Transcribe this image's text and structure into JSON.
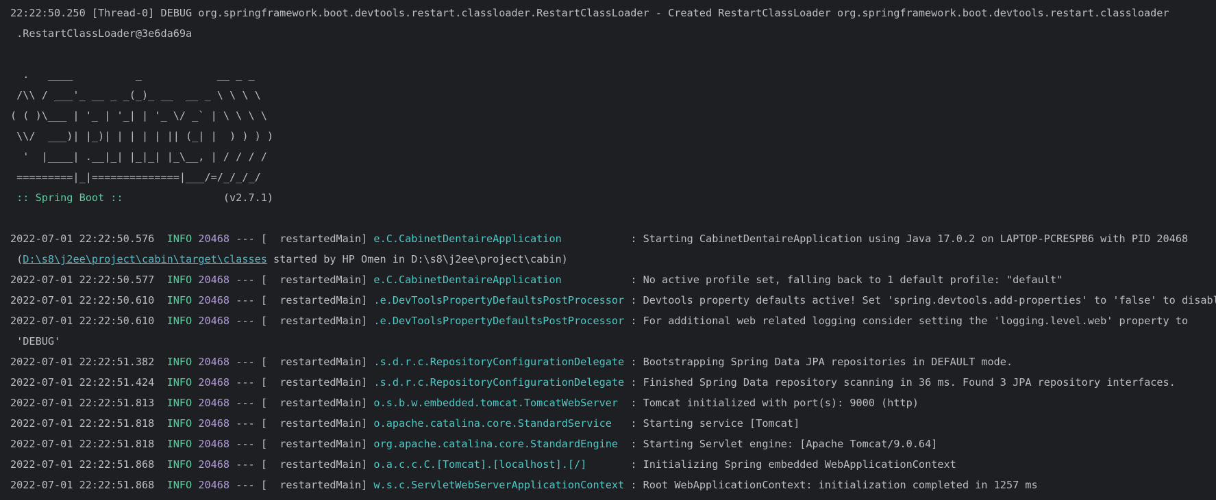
{
  "debug_line": {
    "part1": "22:22:50.250 [Thread-0] DEBUG org.springframework.boot.devtools.restart.classloader.RestartClassLoader - Created RestartClassLoader org.springframework.boot.devtools.restart.classloader",
    "part2": " .RestartClassLoader@3e6da69a"
  },
  "banner": {
    "lines": [
      "  .   ____          _            __ _ _",
      " /\\\\ / ___'_ __ _ _(_)_ __  __ _ \\ \\ \\ \\",
      "( ( )\\___ | '_ | '_| | '_ \\/ _` | \\ \\ \\ \\",
      " \\\\/  ___)| |_)| | | | | || (_| |  ) ) ) )",
      "  '  |____| .__|_| |_|_| |_\\__, | / / / /",
      " =========|_|==============|___/=/_/_/_/"
    ],
    "spring_label": " :: Spring Boot :: ",
    "version": "               (v2.7.1)"
  },
  "logs": [
    {
      "ts": "2022-07-01 22:22:50.576",
      "level": "INFO",
      "pid": "20468",
      "sep": "---",
      "thread": "[  restartedMain]",
      "logger": "e.C.CabinetDentaireApplication          ",
      "msg": ": Starting CabinetDentaireApplication using Java 17.0.2 on LAPTOP-PCRESPB6 with PID 20468"
    },
    {
      "ts": "2022-07-01 22:22:50.577",
      "level": "INFO",
      "pid": "20468",
      "sep": "---",
      "thread": "[  restartedMain]",
      "logger": "e.C.CabinetDentaireApplication          ",
      "msg": ": No active profile set, falling back to 1 default profile: \"default\""
    },
    {
      "ts": "2022-07-01 22:22:50.610",
      "level": "INFO",
      "pid": "20468",
      "sep": "---",
      "thread": "[  restartedMain]",
      "logger": ".e.DevToolsPropertyDefaultsPostProcessor",
      "msg": ": Devtools property defaults active! Set 'spring.devtools.add-properties' to 'false' to disable"
    },
    {
      "ts": "2022-07-01 22:22:50.610",
      "level": "INFO",
      "pid": "20468",
      "sep": "---",
      "thread": "[  restartedMain]",
      "logger": ".e.DevToolsPropertyDefaultsPostProcessor",
      "msg": ": For additional web related logging consider setting the 'logging.level.web' property to"
    },
    {
      "ts": "2022-07-01 22:22:51.382",
      "level": "INFO",
      "pid": "20468",
      "sep": "---",
      "thread": "[  restartedMain]",
      "logger": ".s.d.r.c.RepositoryConfigurationDelegate",
      "msg": ": Bootstrapping Spring Data JPA repositories in DEFAULT mode."
    },
    {
      "ts": "2022-07-01 22:22:51.424",
      "level": "INFO",
      "pid": "20468",
      "sep": "---",
      "thread": "[  restartedMain]",
      "logger": ".s.d.r.c.RepositoryConfigurationDelegate",
      "msg": ": Finished Spring Data repository scanning in 36 ms. Found 3 JPA repository interfaces."
    },
    {
      "ts": "2022-07-01 22:22:51.813",
      "level": "INFO",
      "pid": "20468",
      "sep": "---",
      "thread": "[  restartedMain]",
      "logger": "o.s.b.w.embedded.tomcat.TomcatWebServer ",
      "msg": ": Tomcat initialized with port(s): 9000 (http)"
    },
    {
      "ts": "2022-07-01 22:22:51.818",
      "level": "INFO",
      "pid": "20468",
      "sep": "---",
      "thread": "[  restartedMain]",
      "logger": "o.apache.catalina.core.StandardService  ",
      "msg": ": Starting service [Tomcat]"
    },
    {
      "ts": "2022-07-01 22:22:51.818",
      "level": "INFO",
      "pid": "20468",
      "sep": "---",
      "thread": "[  restartedMain]",
      "logger": "org.apache.catalina.core.StandardEngine ",
      "msg": ": Starting Servlet engine: [Apache Tomcat/9.0.64]"
    },
    {
      "ts": "2022-07-01 22:22:51.868",
      "level": "INFO",
      "pid": "20468",
      "sep": "---",
      "thread": "[  restartedMain]",
      "logger": "o.a.c.c.C.[Tomcat].[localhost].[/]      ",
      "msg": ": Initializing Spring embedded WebApplicationContext"
    },
    {
      "ts": "2022-07-01 22:22:51.868",
      "level": "INFO",
      "pid": "20468",
      "sep": "---",
      "thread": "[  restartedMain]",
      "logger": "w.s.c.ServletWebServerApplicationContext",
      "msg": ": Root WebApplicationContext: initialization completed in 1257 ms"
    }
  ],
  "continuations": {
    "path_link": "D:\\s8\\j2ee\\project\\cabin\\target\\classes",
    "path_rest": " started by HP Omen in D:\\s8\\j2ee\\project\\cabin)",
    "debug_value": " 'DEBUG'"
  },
  "colors": {
    "background": "#1e1f22",
    "text": "#bcbec4",
    "info": "#5fcca0",
    "pid": "#b39ddb",
    "logger": "#4ec9c6",
    "link": "#56b6c2"
  }
}
